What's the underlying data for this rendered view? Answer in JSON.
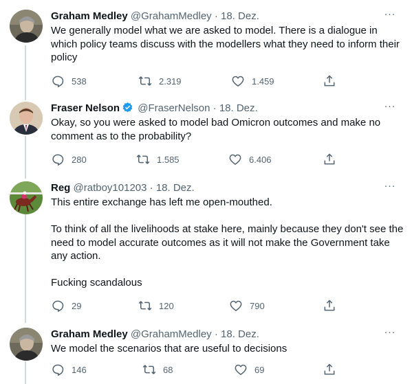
{
  "tweets": [
    {
      "name": "Graham Medley",
      "handle": "@GrahamMedley",
      "date": "· 18. Dez.",
      "lines": [
        "We generally model what we are asked to model. There is a dialogue in which policy teams discuss with the modellers what they need to inform their policy"
      ],
      "replies": "538",
      "retweets": "2.319",
      "likes": "1.459",
      "avatar": "person-avatar-gray",
      "verified": false
    },
    {
      "name": "Fraser Nelson",
      "handle": "@FraserNelson",
      "date": "· 18. Dez.",
      "lines": [
        "Okay, so you were asked to model bad Omicron outcomes and make no comment as to the probability?"
      ],
      "replies": "280",
      "retweets": "1.585",
      "likes": "6.406",
      "avatar": "person-avatar-suit",
      "verified": true
    },
    {
      "name": "Reg",
      "handle": "@ratboy101203",
      "date": "· 18. Dez.",
      "lines": [
        "This entire exchange has left me open-mouthed.",
        "To think of all the livelihoods at stake here, mainly because they don't see the need to model accurate outcomes as it will not make the Government take any action.",
        "Fucking scandalous"
      ],
      "replies": "29",
      "retweets": "120",
      "likes": "790",
      "avatar": "horse-race-avatar",
      "verified": false
    },
    {
      "name": "Graham Medley",
      "handle": "@GrahamMedley",
      "date": "· 18. Dez.",
      "lines": [
        "We model the scenarios that are useful to decisions"
      ],
      "replies": "146",
      "retweets": "68",
      "likes": "69",
      "avatar": "person-avatar-gray",
      "verified": false
    }
  ],
  "more_label": "···",
  "colors": {
    "text": "#0f1419",
    "secondary": "#536471",
    "verified": "#1d9bf0",
    "thread_line": "#cfd9de"
  }
}
